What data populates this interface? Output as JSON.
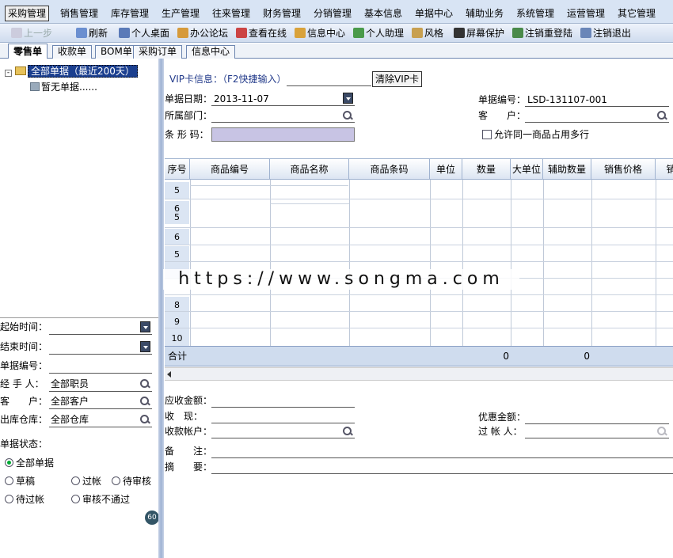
{
  "menu": [
    "采购管理",
    "销售管理",
    "库存管理",
    "生产管理",
    "往来管理",
    "财务管理",
    "分销管理",
    "基本信息",
    "单据中心",
    "辅助业务",
    "系统管理",
    "运营管理",
    "其它管理"
  ],
  "toolbar": {
    "back": "上一步",
    "refresh": "刷新",
    "desktop": "个人桌面",
    "forum": "办公论坛",
    "online": "查看在线",
    "info": "信息中心",
    "assistant": "个人助理",
    "style": "风格",
    "lock": "屏幕保护",
    "relogin": "注销重登陆",
    "logout": "注销退出"
  },
  "tabs": [
    "零售单",
    "收款单",
    "BOM单",
    "采购订单",
    "信息中心"
  ],
  "tree": {
    "root": "全部单据（最近200天）",
    "child": "暂无单据......"
  },
  "filters": {
    "start": "起始时间：",
    "end": "结束时间：",
    "docno": "单据编号：",
    "handler": "经 手 人：",
    "handler_val": "全部职员",
    "customer": "客　　户：",
    "customer_val": "全部客户",
    "warehouse": "出库仓库：",
    "warehouse_val": "全部仓库",
    "status": "单据状态：",
    "radios": [
      "全部单据",
      "草稿",
      "过帐",
      "待审核",
      "待过帐",
      "审核不通过"
    ],
    "badge": "60"
  },
  "form": {
    "vip": "VIP卡信息：（F2快捷输入）",
    "clear_vip": "清除VIP卡",
    "date_lbl": "单据日期：",
    "date": "2013-11-07",
    "docno_lbl": "单据编号：",
    "docno": "LSD-131107-001",
    "dept": "所属部门：",
    "cust": "客　　户：",
    "barcode": "条 形 码：",
    "allow": "允许同一商品占用多行"
  },
  "grid": {
    "headers": [
      "序号",
      "商品编号",
      "商品名称",
      "商品条码",
      "单位",
      "数量",
      "大单位",
      "辅助数量",
      "销售价格",
      "销"
    ],
    "rows": [
      "5",
      "6",
      "5",
      "6",
      "5",
      "",
      "8",
      "9",
      "10"
    ],
    "sum_label": "合计",
    "sum_qty": "0",
    "sum_aux": "0"
  },
  "footer": {
    "receivable": "应收金额：",
    "cash": "收　现：",
    "account": "收款帐户：",
    "discount": "优惠金额：",
    "poster": "过 帐 人：",
    "remark": "备　　注：",
    "summary": "摘　　要："
  },
  "watermark": "https://www.songma.com"
}
